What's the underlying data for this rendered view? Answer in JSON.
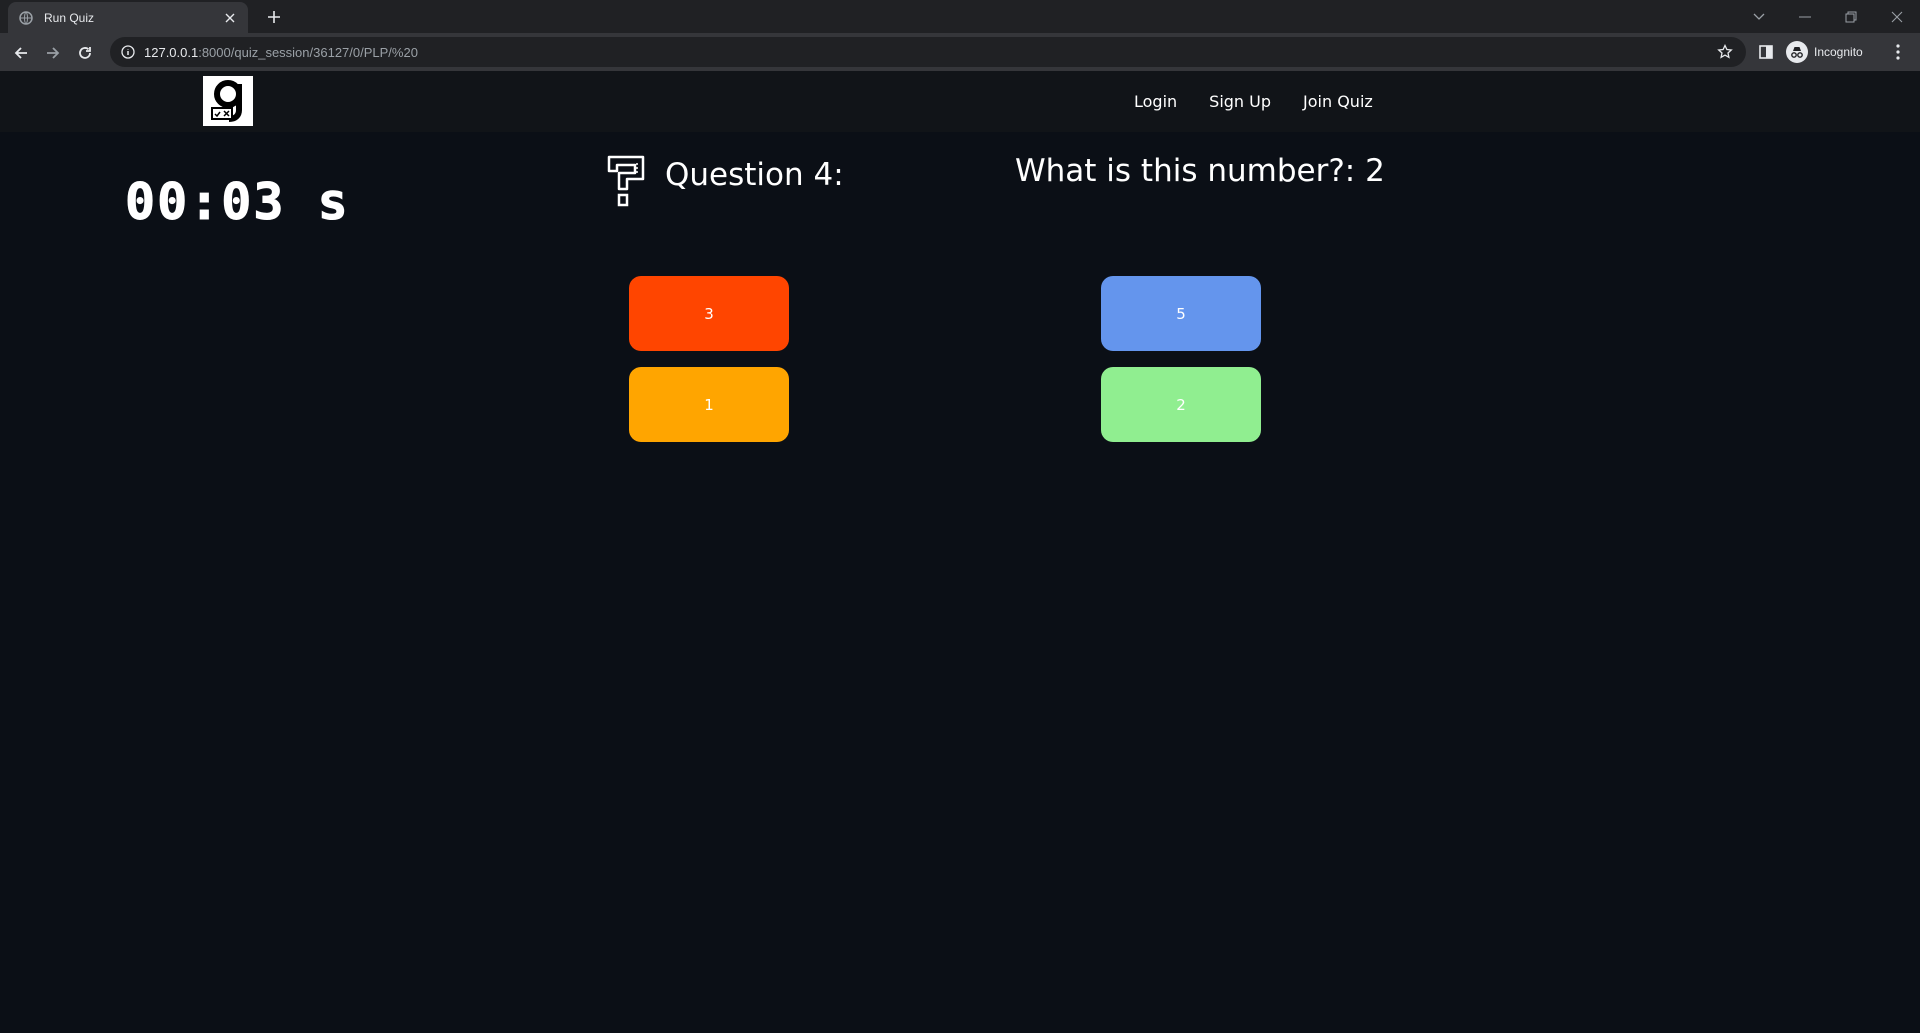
{
  "browser": {
    "tab_title": "Run Quiz",
    "url_host": "127.0.0.1",
    "url_path": ":8000/quiz_session/36127/0/PLP/%20",
    "profile_label": "Incognito"
  },
  "navbar": {
    "links": [
      "Login",
      "Sign Up",
      "Join Quiz"
    ]
  },
  "timer": {
    "display": "00:03 s"
  },
  "question": {
    "label": "Question 4:",
    "text": "What is this number?: 2"
  },
  "answers": [
    {
      "label": "3",
      "color": "#ff4500"
    },
    {
      "label": "5",
      "color": "#6495ed"
    },
    {
      "label": "1",
      "color": "#ffa500"
    },
    {
      "label": "2",
      "color": "#90ee90"
    }
  ]
}
